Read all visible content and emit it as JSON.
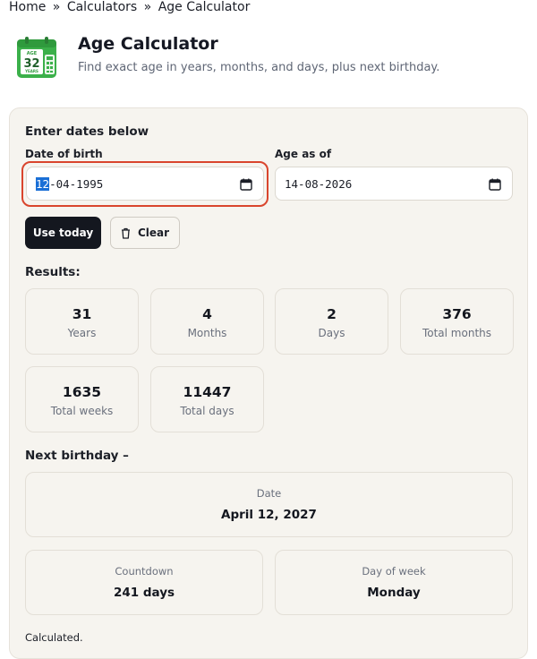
{
  "breadcrumb": {
    "home": "Home",
    "sep1": "»",
    "calculators": "Calculators",
    "sep2": "»",
    "current": "Age Calculator"
  },
  "header": {
    "icon_name": "age-calendar-icon",
    "icon_top_text": "AGE",
    "icon_number": "32",
    "icon_bottom_text": "YEARS",
    "title": "Age Calculator",
    "subtitle": "Find exact age in years, months, and days, plus next birthday."
  },
  "form": {
    "section_title": "Enter dates below",
    "dob_label": "Date of birth",
    "dob_value_selected": "12",
    "dob_value_rest": "-04-1995",
    "asof_label": "Age as of",
    "asof_value": "14-08-2026",
    "use_today_label": "Use today",
    "clear_label": "Clear",
    "focus_color": "#d9452d"
  },
  "results": {
    "title": "Results:",
    "items": [
      {
        "value": "31",
        "label": "Years"
      },
      {
        "value": "4",
        "label": "Months"
      },
      {
        "value": "2",
        "label": "Days"
      },
      {
        "value": "376",
        "label": "Total months"
      },
      {
        "value": "1635",
        "label": "Total weeks"
      },
      {
        "value": "11447",
        "label": "Total days"
      }
    ]
  },
  "next_birthday": {
    "title": "Next birthday –",
    "date_label": "Date",
    "date_value": "April 12, 2027",
    "countdown_label": "Countdown",
    "countdown_value": "241 days",
    "weekday_label": "Day of week",
    "weekday_value": "Monday"
  },
  "status": "Calculated.",
  "colors": {
    "card_bg": "#f6f4ef",
    "primary_button": "#14171f",
    "icon_green": "#3bb04a"
  }
}
